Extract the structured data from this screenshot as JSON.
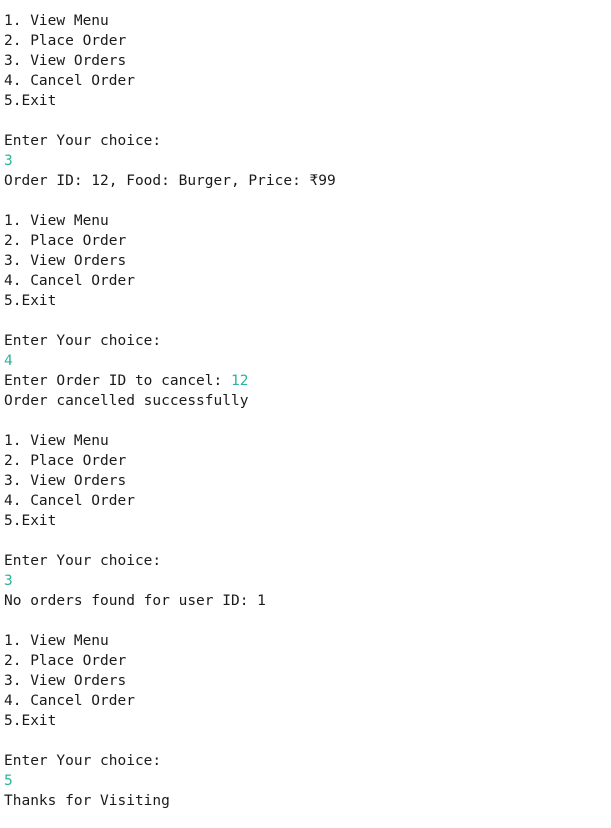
{
  "colors": {
    "background": "#ffffff",
    "text": "#1a1a1a",
    "user_input": "#2bb59a"
  },
  "console": {
    "lines": [
      {
        "text": "1. View Menu",
        "type": "output"
      },
      {
        "text": "2. Place Order",
        "type": "output"
      },
      {
        "text": "3. View Orders",
        "type": "output"
      },
      {
        "text": "4. Cancel Order",
        "type": "output"
      },
      {
        "text": "5.Exit",
        "type": "output"
      },
      {
        "text": "",
        "type": "blank"
      },
      {
        "text": "Enter Your choice:",
        "type": "output"
      },
      {
        "text": "3",
        "type": "input"
      },
      {
        "text": "Order ID: 12, Food: Burger, Price: ₹99",
        "type": "output"
      },
      {
        "text": "",
        "type": "blank"
      },
      {
        "text": "1. View Menu",
        "type": "output"
      },
      {
        "text": "2. Place Order",
        "type": "output"
      },
      {
        "text": "3. View Orders",
        "type": "output"
      },
      {
        "text": "4. Cancel Order",
        "type": "output"
      },
      {
        "text": "5.Exit",
        "type": "output"
      },
      {
        "text": "",
        "type": "blank"
      },
      {
        "text": "Enter Your choice:",
        "type": "output"
      },
      {
        "text": "4",
        "type": "input"
      },
      {
        "text": "Enter Order ID to cancel: ",
        "input": "12",
        "type": "prompt"
      },
      {
        "text": "Order cancelled successfully",
        "type": "output"
      },
      {
        "text": "",
        "type": "blank"
      },
      {
        "text": "1. View Menu",
        "type": "output"
      },
      {
        "text": "2. Place Order",
        "type": "output"
      },
      {
        "text": "3. View Orders",
        "type": "output"
      },
      {
        "text": "4. Cancel Order",
        "type": "output"
      },
      {
        "text": "5.Exit",
        "type": "output"
      },
      {
        "text": "",
        "type": "blank"
      },
      {
        "text": "Enter Your choice:",
        "type": "output"
      },
      {
        "text": "3",
        "type": "input"
      },
      {
        "text": "No orders found for user ID: 1",
        "type": "output"
      },
      {
        "text": "",
        "type": "blank"
      },
      {
        "text": "1. View Menu",
        "type": "output"
      },
      {
        "text": "2. Place Order",
        "type": "output"
      },
      {
        "text": "3. View Orders",
        "type": "output"
      },
      {
        "text": "4. Cancel Order",
        "type": "output"
      },
      {
        "text": "5.Exit",
        "type": "output"
      },
      {
        "text": "",
        "type": "blank"
      },
      {
        "text": "Enter Your choice:",
        "type": "output"
      },
      {
        "text": "5",
        "type": "input"
      },
      {
        "text": "Thanks for Visiting",
        "type": "output"
      }
    ]
  }
}
